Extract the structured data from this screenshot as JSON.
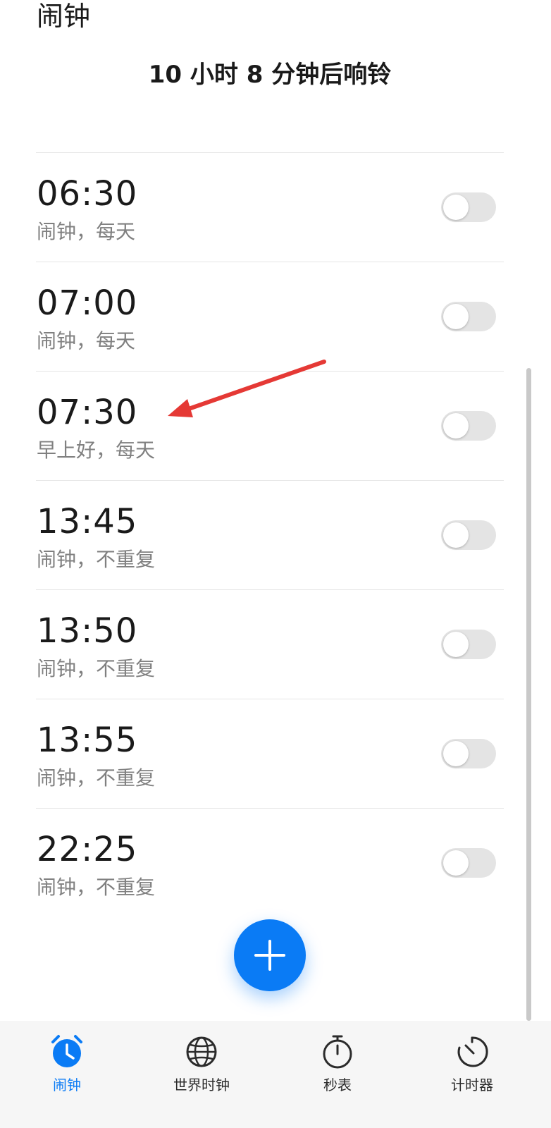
{
  "header": {
    "title": "闹钟",
    "next_alarm_text": "10 小时 8 分钟后响铃"
  },
  "alarms": [
    {
      "time": "06:30",
      "desc": "闹钟，每天",
      "enabled": false
    },
    {
      "time": "07:00",
      "desc": "闹钟，每天",
      "enabled": false
    },
    {
      "time": "07:30",
      "desc": "早上好，每天",
      "enabled": false
    },
    {
      "time": "13:45",
      "desc": "闹钟，不重复",
      "enabled": false
    },
    {
      "time": "13:50",
      "desc": "闹钟，不重复",
      "enabled": false
    },
    {
      "time": "13:55",
      "desc": "闹钟，不重复",
      "enabled": false
    },
    {
      "time": "22:25",
      "desc": "闹钟，不重复",
      "enabled": false
    }
  ],
  "fab": {
    "icon": "plus-icon"
  },
  "bottom_nav": {
    "items": [
      {
        "label": "闹钟",
        "icon": "alarm-clock-icon",
        "active": true
      },
      {
        "label": "世界时钟",
        "icon": "globe-icon",
        "active": false
      },
      {
        "label": "秒表",
        "icon": "stopwatch-icon",
        "active": false
      },
      {
        "label": "计时器",
        "icon": "timer-icon",
        "active": false
      }
    ]
  },
  "colors": {
    "accent": "#0a7bf5",
    "toggle_off": "#e4e4e4",
    "annotation_arrow": "#e53935"
  }
}
